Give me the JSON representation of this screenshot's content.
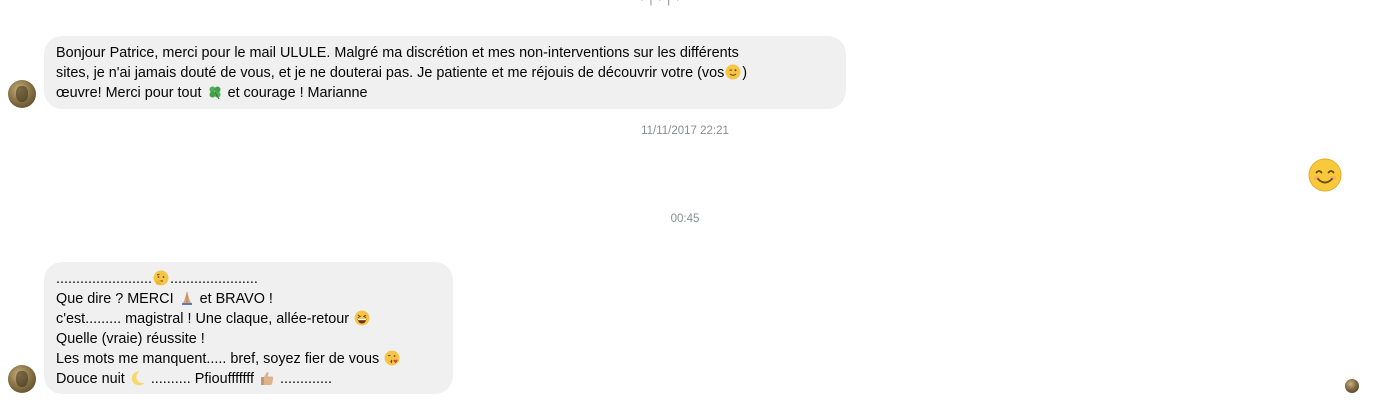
{
  "top_fragment": "· |  ·  |  ·",
  "messages": [
    {
      "lines": [
        "Bonjour Patrice, merci pour le mail ULULE. Malgré ma discrétion et mes non-interventions sur les différents",
        "sites, je n'ai jamais douté de vous, et je ne douterai pas. Je patiente et me réjouis de découvrir votre (vos",
        ")",
        "œuvre! Merci pour tout",
        "et courage ! Marianne"
      ]
    },
    {
      "lines": [
        "........................",
        "......................",
        "Que dire ? MERCI",
        "et BRAVO !",
        "c'est......... magistral ! Une claque, allée-retour",
        "Quelle (vraie) réussite !",
        "Les mots me manquent..... bref, soyez fier de vous",
        "Douce nuit",
        ".......... Pfioufffffff",
        "............."
      ]
    }
  ],
  "timestamps": [
    "11/11/2017 22:21",
    "00:45"
  ],
  "icons": {
    "wink": "winking-face-icon",
    "clover": "four-leaf-clover-icon",
    "thinking": "thinking-face-icon",
    "pray": "folded-hands-icon",
    "laugh": "grinning-squinting-face-icon",
    "kiss": "face-blowing-kiss-icon",
    "moon": "crescent-moon-icon",
    "thumb": "thumbs-up-icon",
    "smile": "smiling-face-with-smiling-eyes-icon"
  },
  "colors": {
    "bubble_bg": "#f0f0f0",
    "timestamp": "#8a8d91",
    "text": "#050505"
  }
}
